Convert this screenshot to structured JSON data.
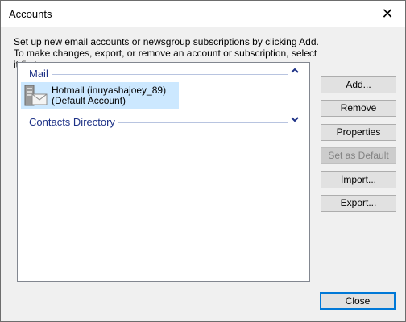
{
  "window": {
    "title": "Accounts",
    "close_glyph": "✕"
  },
  "instructions": {
    "line1": "Set up new email accounts or newsgroup subscriptions by clicking Add.",
    "line2": "To make changes, export, or remove an account or subscription, select it first."
  },
  "groups": [
    {
      "label": "Mail",
      "chevron": "⌃",
      "expanded": true,
      "accounts": [
        {
          "name": "Hotmail (inuyashajoey_89)",
          "subtitle": "(Default Account)",
          "icon": "mail-server-icon",
          "selected": true
        }
      ]
    },
    {
      "label": "Contacts Directory",
      "chevron": "⌄",
      "expanded": false
    }
  ],
  "buttons": {
    "add": "Add...",
    "remove": "Remove",
    "properties": "Properties",
    "set_default": "Set as Default",
    "import": "Import...",
    "export": "Export...",
    "close": "Close"
  },
  "colors": {
    "group_label": "#1e3287",
    "selection": "#cce8ff",
    "focus_border": "#0078d7"
  }
}
